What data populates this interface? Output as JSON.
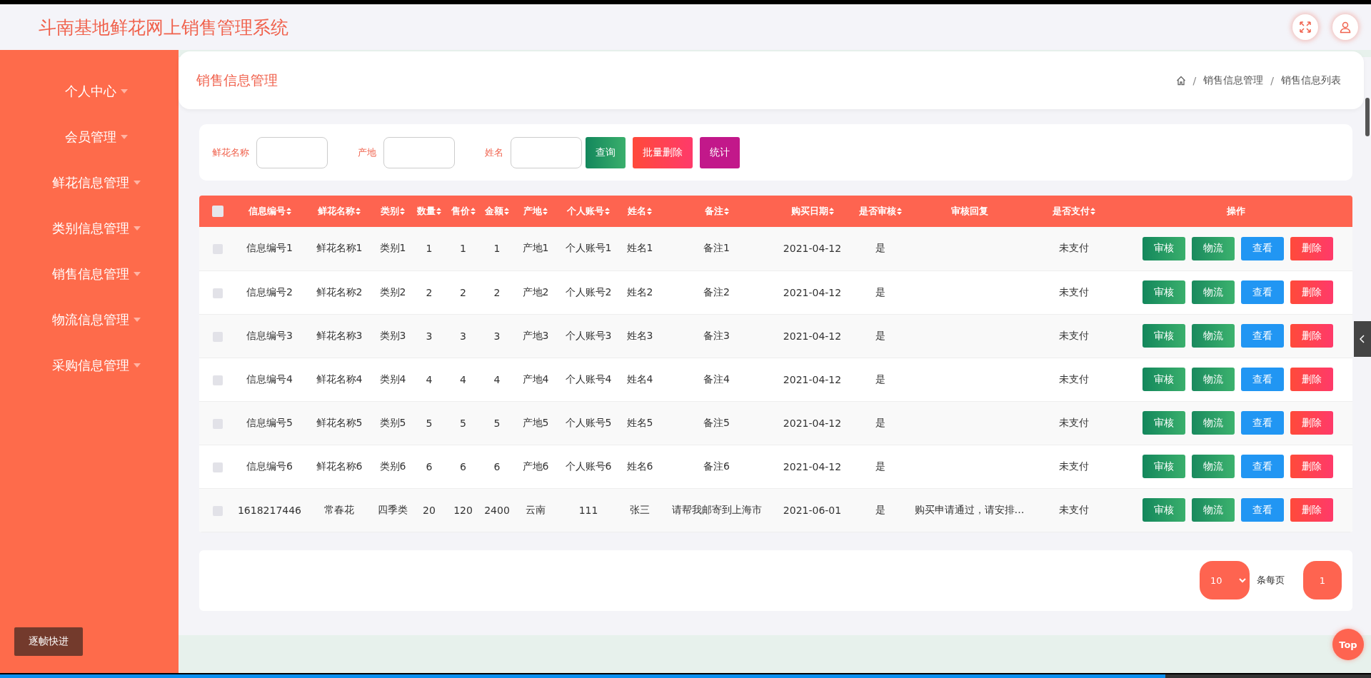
{
  "app": {
    "title": "斗南基地鲜花网上销售管理系统"
  },
  "sidebar": {
    "items": [
      {
        "label": "个人中心"
      },
      {
        "label": "会员管理"
      },
      {
        "label": "鲜花信息管理"
      },
      {
        "label": "类别信息管理"
      },
      {
        "label": "销售信息管理"
      },
      {
        "label": "物流信息管理"
      },
      {
        "label": "采购信息管理"
      }
    ]
  },
  "page_header": {
    "title": "销售信息管理",
    "breadcrumb": [
      {
        "separator": "/",
        "label": "销售信息管理"
      },
      {
        "separator": "/",
        "label": "销售信息列表"
      }
    ]
  },
  "search": {
    "fields": [
      {
        "label": "鲜花名称"
      },
      {
        "label": "产地"
      },
      {
        "label": "姓名"
      }
    ],
    "buttons": [
      {
        "label": "查询",
        "kind": "query"
      },
      {
        "label": "批量删除",
        "kind": "delete"
      },
      {
        "label": "统计",
        "kind": "stats"
      }
    ]
  },
  "table": {
    "select_all_checked": false,
    "columns": [
      {
        "label": "信息编号",
        "sortable": true
      },
      {
        "label": "鲜花名称",
        "sortable": true
      },
      {
        "label": "类别",
        "sortable": true
      },
      {
        "label": "数量",
        "sortable": true
      },
      {
        "label": "售价",
        "sortable": true
      },
      {
        "label": "金额",
        "sortable": true
      },
      {
        "label": "产地",
        "sortable": true
      },
      {
        "label": "个人账号",
        "sortable": true
      },
      {
        "label": "姓名",
        "sortable": true
      },
      {
        "label": "备注",
        "sortable": true
      },
      {
        "label": "购买日期",
        "sortable": true
      },
      {
        "label": "是否审核",
        "sortable": true
      },
      {
        "label": "审核回复",
        "sortable": false
      },
      {
        "label": "是否支付",
        "sortable": true
      },
      {
        "label": "操作",
        "sortable": false
      }
    ],
    "rows": [
      {
        "checked": false,
        "cells": [
          "信息编号1",
          "鲜花名称1",
          "类别1",
          "1",
          "1",
          "1",
          "产地1",
          "个人账号1",
          "姓名1",
          "备注1",
          "2021-04-12",
          "是",
          "",
          "未支付"
        ],
        "actions": [
          "审核",
          "物流",
          "查看",
          "删除"
        ]
      },
      {
        "checked": false,
        "cells": [
          "信息编号2",
          "鲜花名称2",
          "类别2",
          "2",
          "2",
          "2",
          "产地2",
          "个人账号2",
          "姓名2",
          "备注2",
          "2021-04-12",
          "是",
          "",
          "未支付"
        ],
        "actions": [
          "审核",
          "物流",
          "查看",
          "删除"
        ]
      },
      {
        "checked": false,
        "cells": [
          "信息编号3",
          "鲜花名称3",
          "类别3",
          "3",
          "3",
          "3",
          "产地3",
          "个人账号3",
          "姓名3",
          "备注3",
          "2021-04-12",
          "是",
          "",
          "未支付"
        ],
        "actions": [
          "审核",
          "物流",
          "查看",
          "删除"
        ]
      },
      {
        "checked": false,
        "cells": [
          "信息编号4",
          "鲜花名称4",
          "类别4",
          "4",
          "4",
          "4",
          "产地4",
          "个人账号4",
          "姓名4",
          "备注4",
          "2021-04-12",
          "是",
          "",
          "未支付"
        ],
        "actions": [
          "审核",
          "物流",
          "查看",
          "删除"
        ]
      },
      {
        "checked": false,
        "cells": [
          "信息编号5",
          "鲜花名称5",
          "类别5",
          "5",
          "5",
          "5",
          "产地5",
          "个人账号5",
          "姓名5",
          "备注5",
          "2021-04-12",
          "是",
          "",
          "未支付"
        ],
        "actions": [
          "审核",
          "物流",
          "查看",
          "删除"
        ]
      },
      {
        "checked": false,
        "cells": [
          "信息编号6",
          "鲜花名称6",
          "类别6",
          "6",
          "6",
          "6",
          "产地6",
          "个人账号6",
          "姓名6",
          "备注6",
          "2021-04-12",
          "是",
          "",
          "未支付"
        ],
        "actions": [
          "审核",
          "物流",
          "查看",
          "删除"
        ]
      },
      {
        "checked": false,
        "cells": [
          "1618217446",
          "常春花",
          "四季类",
          "20",
          "120",
          "2400",
          "云南",
          "111",
          "张三",
          "请帮我邮寄到上海市",
          "2021-06-01",
          "是",
          "购买申请通过，请安排…",
          "未支付"
        ],
        "actions": [
          "审核",
          "物流",
          "查看",
          "删除"
        ]
      }
    ]
  },
  "pagination": {
    "page_size": "10",
    "page_size_label": "条每页",
    "page": "1"
  },
  "top_button": "Top",
  "video_controls": {
    "button": "逐帧快进",
    "progress": {
      "level": 0.85
    }
  }
}
